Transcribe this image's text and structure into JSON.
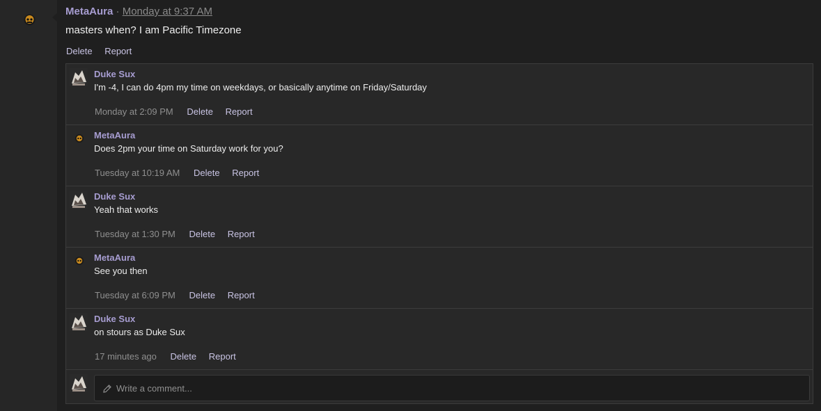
{
  "post": {
    "author": "MetaAura",
    "separator": "·",
    "time": "Monday at 9:37 AM",
    "body": "masters when? I am Pacific Timezone",
    "actions": {
      "delete": "Delete",
      "report": "Report"
    }
  },
  "comments": [
    {
      "author": "Duke Sux",
      "text": "I'm -4, I can do 4pm my time on weekdays, or basically anytime on Friday/Saturday",
      "time": "Monday at 2:09 PM",
      "delete": "Delete",
      "report": "Report",
      "avatar": "duke-avatar"
    },
    {
      "author": "MetaAura",
      "text": "Does 2pm your time on Saturday work for you?",
      "time": "Tuesday at 10:19 AM",
      "delete": "Delete",
      "report": "Report",
      "avatar": "metaaura-avatar"
    },
    {
      "author": "Duke Sux",
      "text": "Yeah that works",
      "time": "Tuesday at 1:30 PM",
      "delete": "Delete",
      "report": "Report",
      "avatar": "duke-avatar"
    },
    {
      "author": "MetaAura",
      "text": "See you then",
      "time": "Tuesday at 6:09 PM",
      "delete": "Delete",
      "report": "Report",
      "avatar": "metaaura-avatar"
    },
    {
      "author": "Duke Sux",
      "text": "on stours as Duke Sux",
      "time": "17 minutes ago",
      "delete": "Delete",
      "report": "Report",
      "avatar": "duke-avatar"
    }
  ],
  "compose": {
    "placeholder": "Write a comment...",
    "icon": "pencil-icon"
  },
  "colors": {
    "accent_author": "#a79dd1",
    "background": "#1f1f1f",
    "panel": "#282828"
  }
}
